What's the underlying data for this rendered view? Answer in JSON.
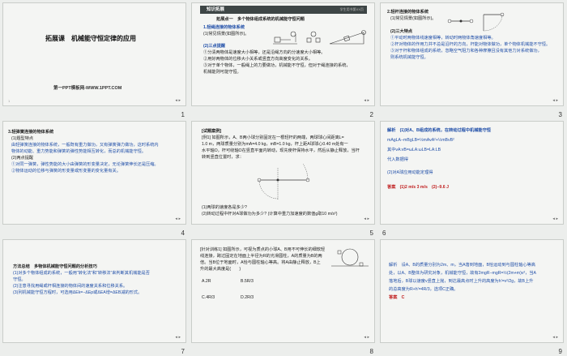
{
  "slides": [
    {
      "number": "1",
      "title": "拓展课　机械能守恒定律的应用",
      "footer": "第一PPT模板网-WWW.1PPT.COM"
    },
    {
      "number": "2",
      "header": "知识拓展",
      "header_right": "学生用书第XX页",
      "subtitle": "拓展点一　多个物体组成系统的机械能守恒问题",
      "lines": [
        "1.轻绳连接的物体系统",
        "(1)常见情景(如图所示)。",
        "(2)三点提醒",
        "①分清两物体是速度大小相等，还是沿绳方向的分速度大小相等。",
        "②用好两物体的位移大小关系或竖直方向高度变化的关系。",
        "③对于单个物体，一般绳上的力要做功，机械能不守恒，但对于绳连接的系统，",
        "机械能则可能守恒。"
      ]
    },
    {
      "number": "3",
      "lines": [
        "2.轻杆连接的物体系统",
        "(1)常见情景(如图所示)。",
        "(2)三大特点",
        "①平动时两物体线速度相等，转动时两物体角速度相等。",
        "②杆对物体的作用力并不总是沿杆的方向，杆能对物体做功，单个物体机械能不守恒。",
        "③对于杆和物体组成的系统，忽略空气阻力和各种摩擦且没有其他力对系统做功，",
        "则系统机械能守恒。"
      ]
    },
    {
      "number": "4",
      "lines": [
        "3.轻弹簧连接的物体系统",
        "(1)题型特点",
        "由轻弹簧连接的物体系统，一般既有重力做功，又有弹簧弹力做功，这时系统内",
        "物体的动能、重力势能和弹簧的弹性势能相互转化，而总的机械能守恒。",
        "(2)两点提醒",
        "①对同一弹簧，弹性势能的大小由弹簧的形变量决定，无论弹簧伸长还是压缩。",
        "②物体运动的位移与弹簧的形变量或形变量的变化量有关。"
      ]
    },
    {
      "number": "5",
      "lines": [
        "[试题案例]",
        "[例1] 如图所示，A、B两小球分别固定在一根轻杆的两端，两球球心间距离L=",
        "1.0 m，两球质量分别为mA=4.0 kg，mB=1.0 kg，杆上距A球球心0.40 m处有一",
        "水平轴O，杆可绕轴O在竖直平面内转动，现先使杆保持水平，然后从静止释放，当杆",
        "转到竖直位置时，求：",
        "(1)两球的速度各是多少?",
        "(2)转动过程中杆对A球做功为多少? (计算中重力加速度的数值g取10 m/s²)"
      ]
    },
    {
      "number": "6",
      "lines": [
        "解析　(1)对A、B组成的系统，在转动过程中机械能守恒",
        "mAgLA−mBgLB=½mAvA²+½mBvB²",
        "其中vA∶vB=ωLA∶ωLB=LA∶LB",
        "代入数据得",
        "(2)对A球应用动能定理得",
        "答案　(1)2 m/s  3 m/s　(2)−9.6 J"
      ]
    },
    {
      "number": "7",
      "lines": [
        "方法总结　多物体机械能守恒问题的分析技巧",
        "(1)对多个物体组成的系统，一般用“转化法”和“转移法”来判断其机械能是否",
        "守恒。",
        "(2)注意寻找用绳或杆相连接的物体间的速度关系和位移关系。",
        "(3)列机械能守恒方程时，可选用ΔEk=−ΔEp或ΔEA增=ΔEB减的形式。"
      ]
    },
    {
      "number": "8",
      "lines": [
        "[针对训练1] 如图所示，可视为质点的小球A、B用不可伸长的细软轻",
        "线连接，跨过固定在地面上半径为R的光滑圆柱，A的质量为B的两",
        "倍。当B位于地面时，A恰与圆柱轴心等高。将A由静止释放，B上",
        "升的最大高度是(　　)",
        "A.2R",
        "B.5R/3",
        "C.4R/3",
        "D.2R/3"
      ]
    },
    {
      "number": "9",
      "lines": [
        "解析　设A、B的质量分别为2m、m，当A落到地面，B恰运动到与圆柱轴心等高",
        "处，以A、B整体为研究对象，机械能守恒，故有2mgR−mgR=½(2m+m)v²，当A",
        "落地后，B球以速度v竖直上抛，到达最高点时上升的高度为h'=v²/2g，故B上升",
        "的总高度为R+h'=4R/3，选项C正确。",
        "答案　C"
      ]
    }
  ]
}
